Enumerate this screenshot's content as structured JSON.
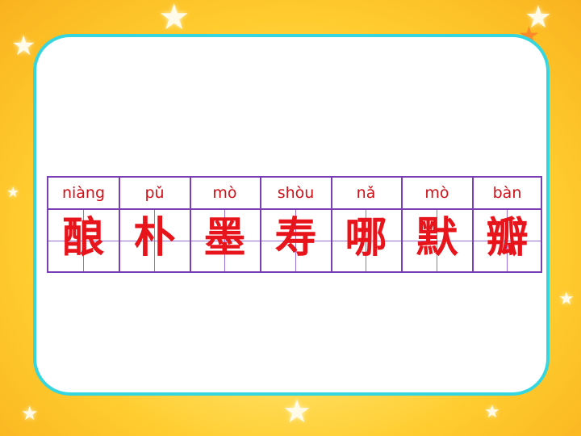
{
  "lesson": {
    "characters": [
      {
        "pinyin": "niàng",
        "hanzi": "酿"
      },
      {
        "pinyin": "pǔ",
        "hanzi": "朴"
      },
      {
        "pinyin": "mò",
        "hanzi": "墨"
      },
      {
        "pinyin": "shòu",
        "hanzi": "寿"
      },
      {
        "pinyin": "nǎ",
        "hanzi": "哪"
      },
      {
        "pinyin": "mò",
        "hanzi": "默"
      },
      {
        "pinyin": "bàn",
        "hanzi": "瓣"
      }
    ]
  },
  "colors": {
    "panel_border": "#35d6e0",
    "grid_lines": "#7a3fb5",
    "text_red": "#e8141c",
    "background": "#ffcc2e"
  }
}
